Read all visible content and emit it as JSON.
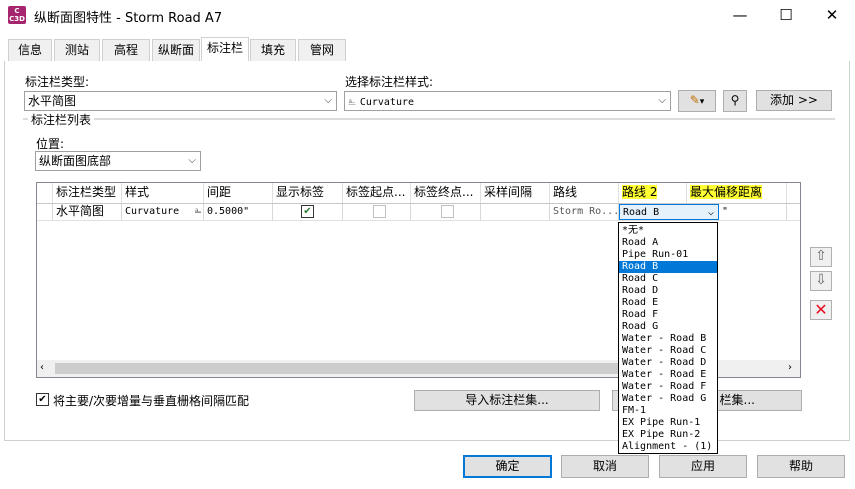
{
  "window": {
    "title": "纵断面图特性 - Storm Road A7",
    "app_icon": "C\nC3D",
    "minimize_glyph": "—",
    "maximize_glyph": "☐",
    "close_glyph": "✕"
  },
  "tabs": [
    {
      "label": "信息"
    },
    {
      "label": "测站"
    },
    {
      "label": "高程"
    },
    {
      "label": "纵断面"
    },
    {
      "label": "标注栏",
      "active": true
    },
    {
      "label": "填充"
    },
    {
      "label": "管网"
    }
  ],
  "band_type": {
    "label": "标注栏类型:",
    "value": "水平简图"
  },
  "band_style": {
    "label": "选择标注栏样式:",
    "value": "Curvature",
    "add_label": "添加 >>"
  },
  "band_list": {
    "label": "标注栏列表",
    "position_label": "位置:",
    "position_value": "纵断面图底部"
  },
  "grid": {
    "headers": [
      "标注栏类型",
      "样式",
      "间距",
      "显示标签",
      "标签起点...",
      "标签终点...",
      "采样间隔",
      "路线",
      "路线 2",
      "最大偏移距离"
    ],
    "row": {
      "type": "水平简图",
      "style": "Curvature",
      "gap": "0.5000\"",
      "show_labels": true,
      "label_start": false,
      "label_end": false,
      "sample": "",
      "alignment": "Storm Ro...",
      "alignment2": "Road B",
      "max_offset": "\""
    }
  },
  "dropdown": {
    "selected": "Road B",
    "options": [
      "*无*",
      "Road A",
      "Pipe Run-01",
      "Road B",
      "Road C",
      "Road D",
      "Road E",
      "Road F",
      "Road G",
      "Water - Road B",
      "Water - Road C",
      "Water - Road D",
      "Water - Road E",
      "Water - Road F",
      "Water - Road G",
      "FM-1",
      "EX Pipe Run-1",
      "EX Pipe Run-2",
      "Alignment - (1)"
    ]
  },
  "match_checkbox": {
    "label": "将主要/次要增量与垂直栅格间隔匹配",
    "checked": true
  },
  "import_button": "导入标注栏集...",
  "save_button_partial": "栏集...",
  "footer": {
    "ok": "确定",
    "cancel": "取消",
    "apply": "应用",
    "help": "帮助"
  },
  "colors": {
    "highlight": "#ffff33",
    "selection": "#0078d7",
    "delete": "#e81123"
  }
}
